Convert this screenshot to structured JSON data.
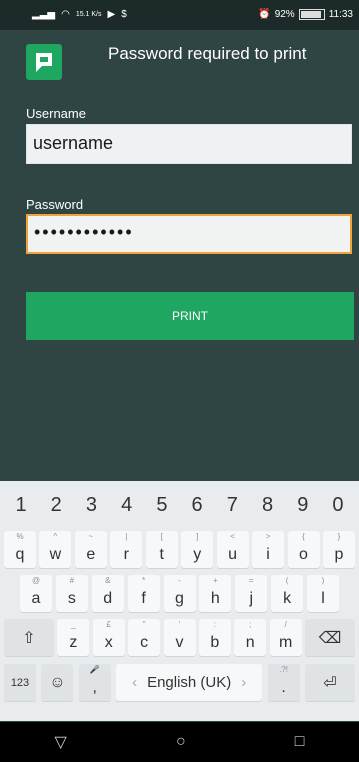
{
  "status": {
    "signal_text": "15.1 K/s",
    "battery_pct": "92%",
    "time": "11:33"
  },
  "header": {
    "title": "Password required to print"
  },
  "form": {
    "username_label": "Username",
    "username_value": "username",
    "password_label": "Password",
    "password_value": "••••••••••••",
    "print_label": "PRINT"
  },
  "keyboard": {
    "numbers": [
      "1",
      "2",
      "3",
      "4",
      "5",
      "6",
      "7",
      "8",
      "9",
      "0"
    ],
    "row1": [
      {
        "k": "q",
        "h": "%"
      },
      {
        "k": "w",
        "h": "^"
      },
      {
        "k": "e",
        "h": "~"
      },
      {
        "k": "r",
        "h": "|"
      },
      {
        "k": "t",
        "h": "["
      },
      {
        "k": "y",
        "h": "]"
      },
      {
        "k": "u",
        "h": "<"
      },
      {
        "k": "i",
        "h": ">"
      },
      {
        "k": "o",
        "h": "{"
      },
      {
        "k": "p",
        "h": "}"
      }
    ],
    "row2": [
      {
        "k": "a",
        "h": "@"
      },
      {
        "k": "s",
        "h": "#"
      },
      {
        "k": "d",
        "h": "&"
      },
      {
        "k": "f",
        "h": "*"
      },
      {
        "k": "g",
        "h": "-"
      },
      {
        "k": "h",
        "h": "+"
      },
      {
        "k": "j",
        "h": "="
      },
      {
        "k": "k",
        "h": "("
      },
      {
        "k": "l",
        "h": ")"
      }
    ],
    "row3": [
      {
        "k": "z",
        "h": "_"
      },
      {
        "k": "x",
        "h": "£"
      },
      {
        "k": "c",
        "h": "\""
      },
      {
        "k": "v",
        "h": "'"
      },
      {
        "k": "b",
        "h": ":"
      },
      {
        "k": "n",
        "h": ";"
      },
      {
        "k": "m",
        "h": "/"
      }
    ],
    "mode_label": "123",
    "comma": ",",
    "space_label": "English (UK)",
    "period": "."
  }
}
